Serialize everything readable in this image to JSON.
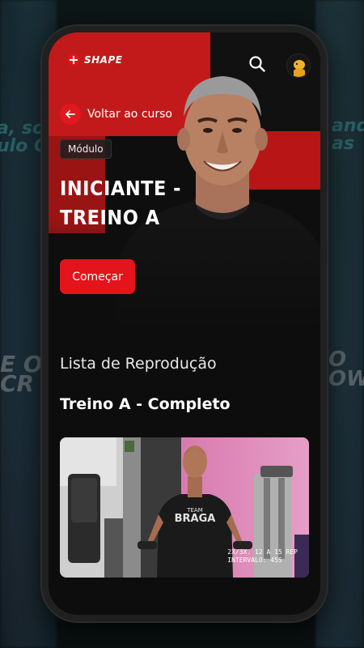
{
  "app": {
    "brand": "SHAPE"
  },
  "background": {
    "left_text": "a, sou\nulo Co",
    "right_text": "ando\nas",
    "left_lower": "E OF\nCR",
    "right_lower": "O\nOW"
  },
  "header": {
    "back_label": "Voltar ao curso",
    "module_tag": "Módulo",
    "title": "INICIANTE - TREINO A",
    "start_button": "Começar"
  },
  "playlist": {
    "heading": "Lista de Reprodução",
    "current_title": "Treino A - Completo",
    "thumbnail": {
      "shirt_text_top": "TEAM",
      "shirt_text": "BRAGA",
      "overlay_line1": "2X/3X. 12 A 15 REP",
      "overlay_line2": "INTERVALO: 45S"
    }
  },
  "colors": {
    "accent": "#e3141b",
    "background": "#0d0d0d"
  },
  "icons": {
    "search": "search-icon",
    "back": "arrow-left-icon",
    "avatar": "user-avatar"
  }
}
